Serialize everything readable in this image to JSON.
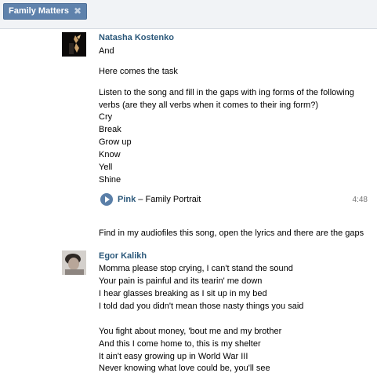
{
  "tab": {
    "label": "Family Matters",
    "close_icon": "close-icon"
  },
  "messages": [
    {
      "author": "Natasha Kostenko",
      "lines": [
        "And",
        "Here comes the task",
        "Listen to the song and fill in the gaps with ing forms of the following",
        "verbs (are they all verbs when it comes to their ing form?)",
        "Cry",
        "Break",
        "Grow up",
        "Know",
        "Yell",
        "Shine"
      ],
      "audio": {
        "artist": "Pink",
        "separator": " – ",
        "title": "Family Portrait",
        "duration": "4:48",
        "icon": "play-icon"
      },
      "after": "Find in my audiofiles this song, open the lyrics and there are the gaps"
    },
    {
      "author": "Egor Kalikh",
      "lines": [
        "Momma please stop crying, I can't stand the sound",
        "Your pain is painful and its tearin' me down",
        "I hear glasses breaking as I sit up in my bed",
        "I told dad you didn't mean those nasty things you said",
        "You fight about money, 'bout me and my brother",
        "And this I come home to, this is my shelter",
        "It ain't easy growing up in World War III",
        "Never knowing what love could be, you'll see"
      ]
    }
  ]
}
